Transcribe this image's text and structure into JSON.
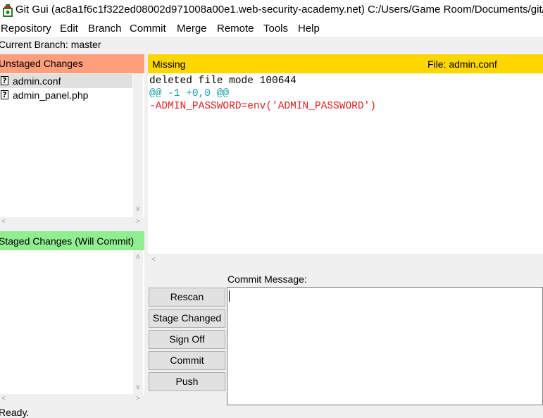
{
  "window": {
    "title": "Git Gui (ac8a1f6c1f322ed08002d971008a00e1.web-security-academy.net) C:/Users/Game Room/Documents/git/a"
  },
  "menu": [
    "Repository",
    "Edit",
    "Branch",
    "Commit",
    "Merge",
    "Remote",
    "Tools",
    "Help"
  ],
  "branch_line": "Current Branch: master",
  "unstaged": {
    "header": "Unstaged Changes",
    "files": [
      {
        "name": "admin.conf",
        "icon": "unknown-file-icon",
        "selected": true
      },
      {
        "name": "admin_panel.php",
        "icon": "unknown-file-icon",
        "selected": false
      }
    ]
  },
  "staged": {
    "header": "Staged Changes (Will Commit)",
    "files": []
  },
  "diff": {
    "status": "Missing",
    "file_label": "File:  admin.conf",
    "lines": [
      {
        "text": "deleted file mode 100644",
        "color": "#000000"
      },
      {
        "text": "@@ -1 +0,0 @@",
        "color": "#1aa3a3"
      },
      {
        "text": "-ADMIN_PASSWORD=env('ADMIN_PASSWORD')",
        "color": "#e02020"
      }
    ]
  },
  "commit": {
    "label": "Commit Message:",
    "message": "",
    "buttons": [
      "Rescan",
      "Stage Changed",
      "Sign Off",
      "Commit",
      "Push"
    ]
  },
  "status_bar": "Ready."
}
